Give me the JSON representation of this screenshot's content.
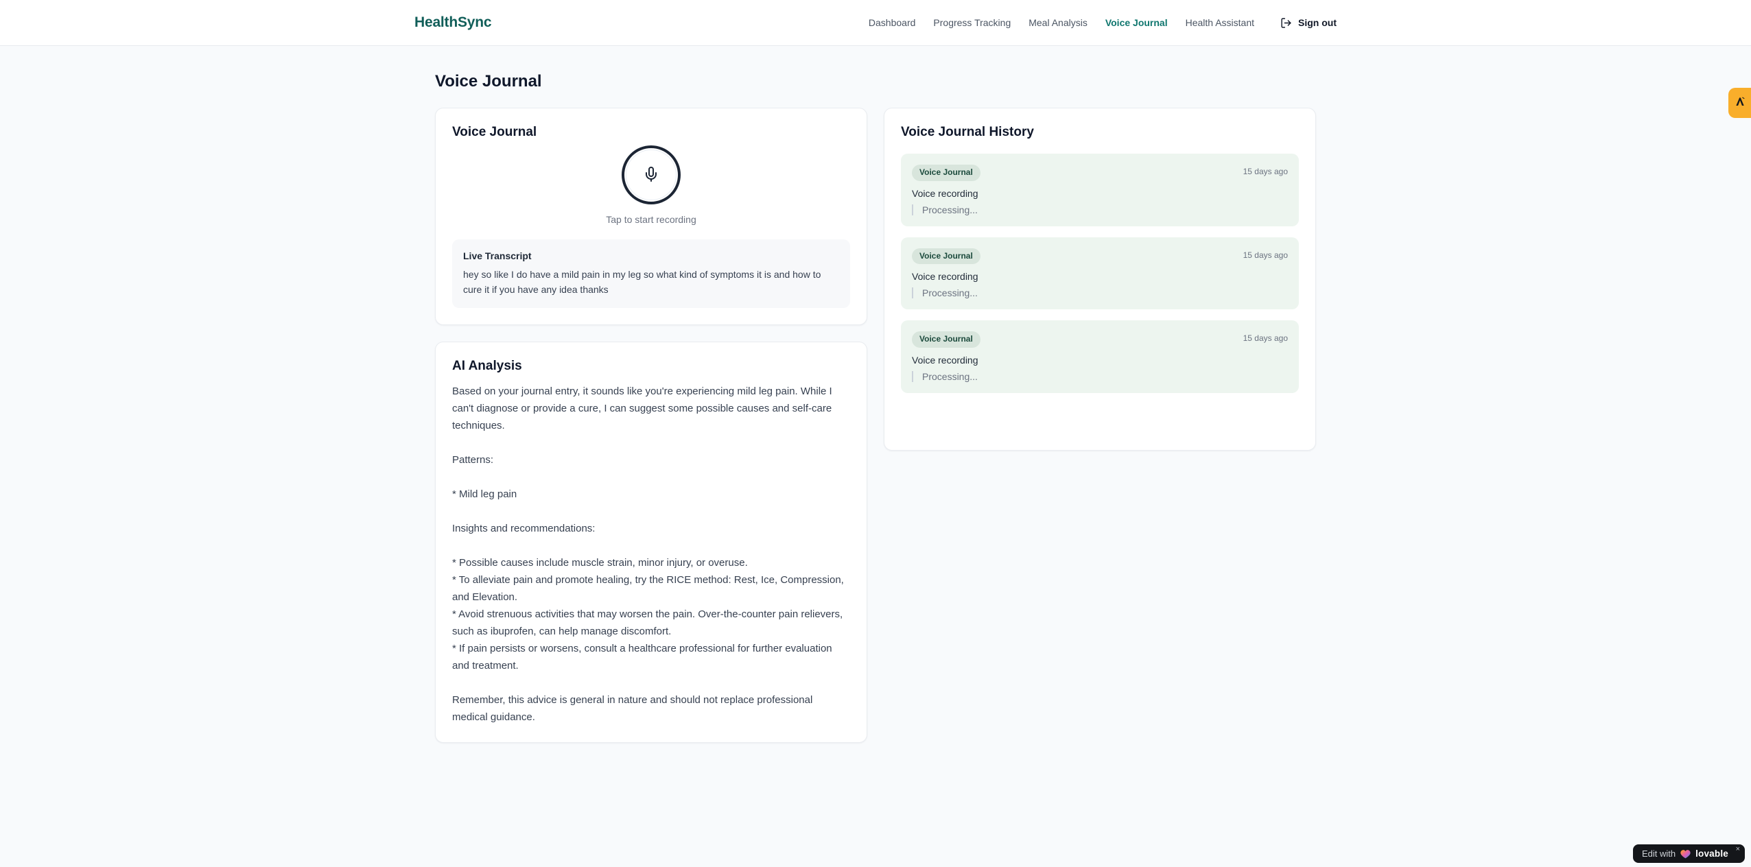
{
  "brand": {
    "name": "HealthSync"
  },
  "nav": {
    "items": [
      {
        "label": "Dashboard",
        "active": false
      },
      {
        "label": "Progress Tracking",
        "active": false
      },
      {
        "label": "Meal Analysis",
        "active": false
      },
      {
        "label": "Voice Journal",
        "active": true
      },
      {
        "label": "Health Assistant",
        "active": false
      }
    ],
    "sign_out_label": "Sign out"
  },
  "page": {
    "title": "Voice Journal"
  },
  "recorder_card": {
    "title": "Voice Journal",
    "tap_hint": "Tap to start recording",
    "transcript_title": "Live Transcript",
    "transcript_text": "hey so like I do have a mild pain in my leg so what kind of symptoms it is and how to cure it if you have any idea thanks"
  },
  "analysis_card": {
    "title": "AI Analysis",
    "body": "Based on your journal entry, it sounds like you're experiencing mild leg pain. While I can't diagnose or provide a cure, I can suggest some possible causes and self-care techniques.\n\nPatterns:\n\n* Mild leg pain\n\nInsights and recommendations:\n\n* Possible causes include muscle strain, minor injury, or overuse.\n* To alleviate pain and promote healing, try the RICE method: Rest, Ice, Compression, and Elevation.\n* Avoid strenuous activities that may worsen the pain. Over-the-counter pain relievers, such as ibuprofen, can help manage discomfort.\n* If pain persists or worsens, consult a healthcare professional for further evaluation and treatment.\n\nRemember, this advice is general in nature and should not replace professional medical guidance."
  },
  "history_card": {
    "title": "Voice Journal History",
    "entries": [
      {
        "badge": "Voice Journal",
        "time": "15 days ago",
        "label": "Voice recording",
        "status": "Processing..."
      },
      {
        "badge": "Voice Journal",
        "time": "15 days ago",
        "label": "Voice recording",
        "status": "Processing..."
      },
      {
        "badge": "Voice Journal",
        "time": "15 days ago",
        "label": "Voice recording",
        "status": "Processing..."
      }
    ]
  },
  "floating": {
    "edit_badge_prefix": "Edit with",
    "edit_badge_brand": "lovable",
    "edit_badge_close": "×"
  },
  "colors": {
    "brand_teal": "#115e59",
    "nav_active": "#0f766e",
    "entry_bg": "#edf5ef",
    "badge_bg": "#d8e5dc",
    "side_tab_amber": "#f9ae2b",
    "page_bg": "#f8fafc"
  }
}
